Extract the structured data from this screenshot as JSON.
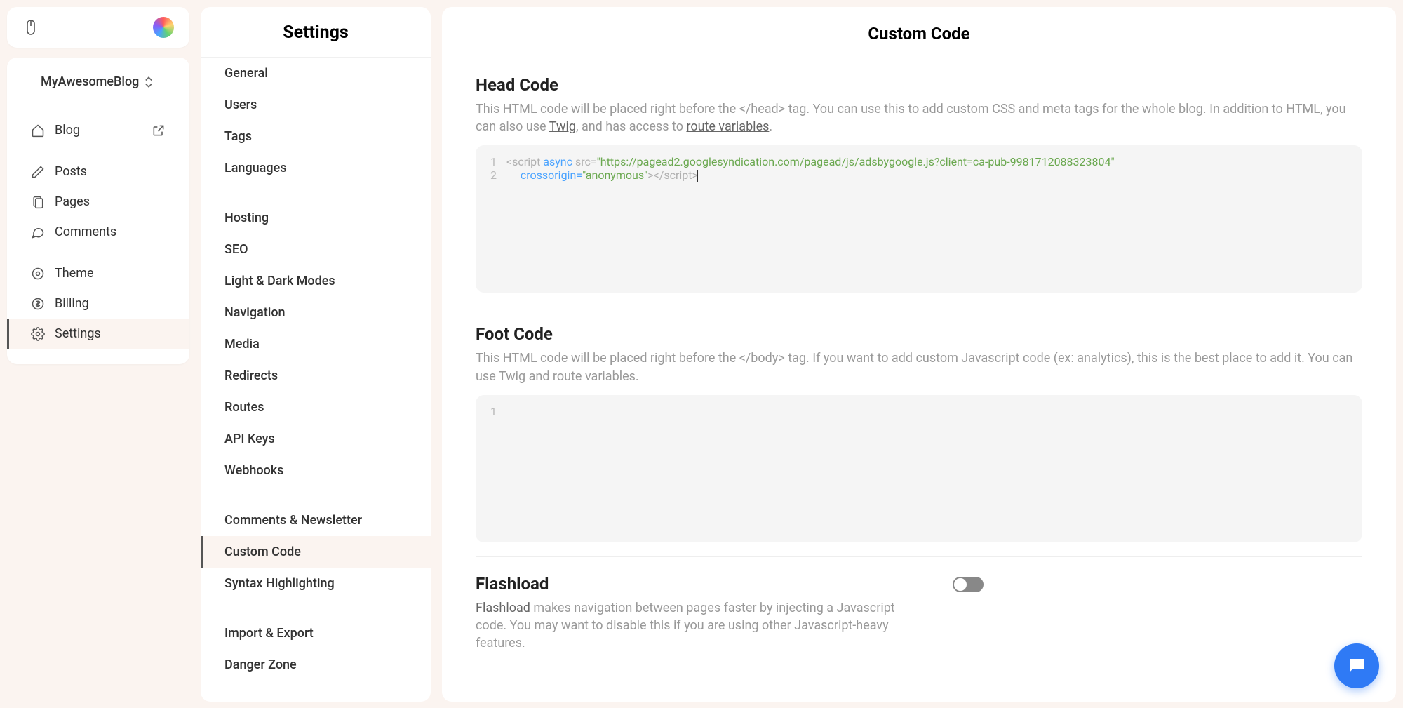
{
  "site_name": "MyAwesomeBlog",
  "nav": {
    "blog": "Blog",
    "posts": "Posts",
    "pages": "Pages",
    "comments": "Comments",
    "theme": "Theme",
    "billing": "Billing",
    "settings": "Settings"
  },
  "settings": {
    "title": "Settings",
    "items": {
      "general": "General",
      "users": "Users",
      "tags": "Tags",
      "languages": "Languages",
      "hosting": "Hosting",
      "seo": "SEO",
      "light_dark": "Light & Dark Modes",
      "navigation": "Navigation",
      "media": "Media",
      "redirects": "Redirects",
      "routes": "Routes",
      "api_keys": "API Keys",
      "webhooks": "Webhooks",
      "comments_newsletter": "Comments & Newsletter",
      "custom_code": "Custom Code",
      "syntax_highlighting": "Syntax Highlighting",
      "import_export": "Import & Export",
      "danger_zone": "Danger Zone"
    }
  },
  "main": {
    "title": "Custom Code",
    "head": {
      "title": "Head Code",
      "help_prefix": "This HTML code will be placed right before the </head> tag. You can use this to add custom CSS and meta tags for the whole blog. In addition to HTML, you can also use ",
      "twig": "Twig",
      "help_mid": ", and has access to ",
      "route_vars": "route variables",
      "help_end": ".",
      "code": {
        "line1_src": "\"https://pagead2.googlesyndication.com/pagead/js/adsbygoogle.js?client=ca-pub-9981712088323804\"",
        "line2_val": "\"anonymous\""
      }
    },
    "foot": {
      "title": "Foot Code",
      "help": "This HTML code will be placed right before the </body> tag. If you want to add custom Javascript code (ex: analytics), this is the best place to add it. You can use Twig and route variables."
    },
    "flashload": {
      "title": "Flashload",
      "link": "Flashload",
      "help_rest": " makes navigation between pages faster by injecting a Javascript code. You may want to disable this if you are using other Javascript-heavy features.",
      "enabled": false
    }
  },
  "literals": {
    "lt_script": "<script ",
    "async": "async",
    "src_eq": " src=",
    "crossorigin_eq": "crossorigin=",
    "close_script": "></script>"
  }
}
